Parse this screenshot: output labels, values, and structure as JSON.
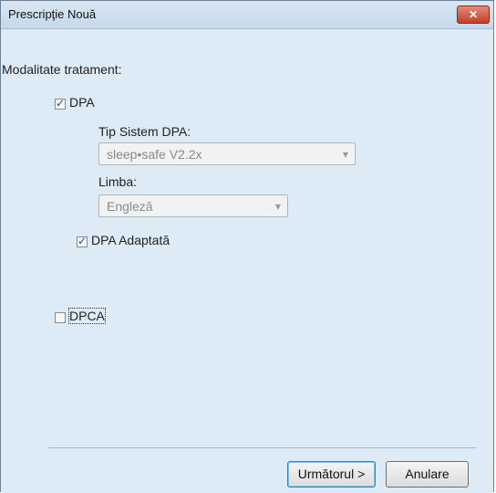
{
  "window": {
    "title": "Prescripţie Nouă",
    "close_label": "✕"
  },
  "form": {
    "modality_label": "Modalitate tratament:",
    "dpa": {
      "label": "DPA",
      "checked": true
    },
    "system_type": {
      "label": "Tip Sistem DPA:",
      "value": "sleep•safe V2.2x",
      "disabled": true
    },
    "language": {
      "label": "Limba:",
      "value": "Engleză",
      "disabled": true
    },
    "dpa_adapted": {
      "label": "DPA Adaptată",
      "checked": true
    },
    "dpca": {
      "label": "DPCA",
      "checked": false
    }
  },
  "buttons": {
    "next_label": "Următorul >",
    "cancel_label": "Anulare"
  },
  "colors": {
    "client_bg": "#dcebf5",
    "close_red": "#c2402a",
    "disabled_text": "#8a8a8a"
  }
}
